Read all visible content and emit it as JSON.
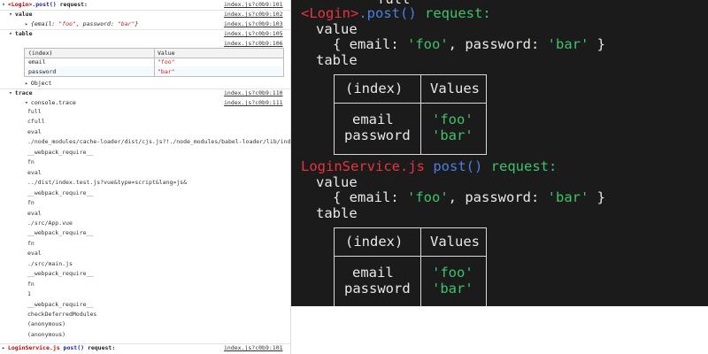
{
  "devtools": {
    "source_101": "index.js?c0b9:101",
    "source_102": "index.js?c0b9:102",
    "source_103": "index.js?c0b9:103",
    "source_105": "index.js?c0b9:105",
    "source_106": "index.js?c0b9:106",
    "source_110": "index.js?c0b9:110",
    "source_111": "index.js?c0b9:111",
    "header1": {
      "component": "<Login>",
      "method": ".post()",
      "rest": " request:"
    },
    "group_value_label": "value",
    "object_preview": {
      "open": "{",
      "k1": "email: ",
      "v1": "\"foo\"",
      "sep": ", ",
      "k2": "password: ",
      "v2": "\"bar\"",
      "close": "}"
    },
    "group_table_label": "table",
    "table": {
      "columns": [
        "(index)",
        "Value"
      ],
      "rows": [
        {
          "index": "email",
          "value": "\"foo\""
        },
        {
          "index": "password",
          "value": "\"bar\""
        }
      ]
    },
    "object_label": "Object",
    "group_trace_label": "trace",
    "console_trace_label": "console.trace",
    "trace_lines": [
      "full",
      "cfull",
      "eval",
      "./node_modules/cache-loader/dist/cjs.js?!./node_modules/babel-loader/lib/index",
      "__webpack_require__",
      "fn",
      "eval",
      "../dist/index.test.js?vue&type=script&lang=js&",
      "__webpack_require__",
      "fn",
      "eval",
      "./src/App.vue",
      "__webpack_require__",
      "fn",
      "eval",
      "./src/main.js",
      "__webpack_require__",
      "fn",
      "1",
      "__webpack_require__",
      "checkDeferredModules",
      "(anonymous)",
      "(anonymous)"
    ],
    "header2": {
      "service": "LoginService.js",
      "method": "post()",
      "rest": " request:"
    }
  },
  "terminal": {
    "top_partial": "full",
    "block1": {
      "component": "<Login>",
      "method": ".post()",
      "rest": " request:",
      "value_label": "value",
      "object": {
        "open": "{ ",
        "k1": "email: ",
        "v1": "'foo'",
        "sep": ", ",
        "k2": "password: ",
        "v2": "'bar'",
        "close": " }"
      },
      "table_label": "table",
      "table": {
        "col_index": "(index)",
        "col_values": "Values",
        "rows": [
          {
            "index": "email",
            "value": "'foo'"
          },
          {
            "index": "password",
            "value": "'bar'"
          }
        ]
      }
    },
    "block2": {
      "service": "LoginService.js",
      "method": "post()",
      "rest": " request:",
      "value_label": "value",
      "object": {
        "open": "{ ",
        "k1": "email: ",
        "v1": "'foo'",
        "sep": ", ",
        "k2": "password: ",
        "v2": "'bar'",
        "close": " }"
      },
      "table_label": "table",
      "table": {
        "col_index": "(index)",
        "col_values": "Values",
        "rows": [
          {
            "index": "email",
            "value": "'foo'"
          },
          {
            "index": "password",
            "value": "'bar'"
          }
        ]
      }
    }
  },
  "colors": {
    "terminal_bg": "#1b1b1b",
    "terminal_red": "#e8333f",
    "terminal_blue": "#4a7fe0",
    "terminal_green": "#3cc46a",
    "devtools_red": "#c80000",
    "devtools_blue": "#1a1aa6"
  }
}
